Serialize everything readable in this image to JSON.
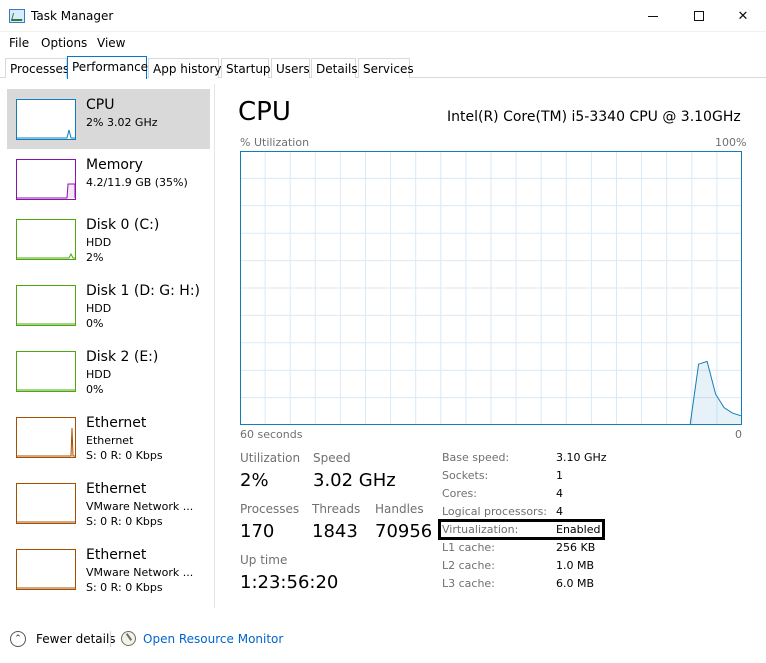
{
  "window": {
    "title": "Task Manager"
  },
  "menu": [
    "File",
    "Options",
    "View"
  ],
  "tabs": [
    "Processes",
    "Performance",
    "App history",
    "Startup",
    "Users",
    "Details",
    "Services"
  ],
  "active_tab": "Performance",
  "resources": [
    {
      "name": "CPU",
      "line1": "2% 3.02 GHz",
      "line2": "",
      "color": "#117dbb"
    },
    {
      "name": "Memory",
      "line1": "4.2/11.9 GB (35%)",
      "line2": "",
      "color": "#8b12ae"
    },
    {
      "name": "Disk 0 (C:)",
      "line1": "HDD",
      "line2": "2%",
      "color": "#4da60c"
    },
    {
      "name": "Disk 1 (D: G: H:)",
      "line1": "HDD",
      "line2": "0%",
      "color": "#4da60c"
    },
    {
      "name": "Disk 2 (E:)",
      "line1": "HDD",
      "line2": "0%",
      "color": "#4da60c"
    },
    {
      "name": "Ethernet",
      "line1": "Ethernet",
      "line2": "S: 0 R: 0 Kbps",
      "color": "#a74f01"
    },
    {
      "name": "Ethernet",
      "line1": "VMware Network ...",
      "line2": "S: 0 R: 0 Kbps",
      "color": "#a74f01"
    },
    {
      "name": "Ethernet",
      "line1": "VMware Network ...",
      "line2": "S: 0 R: 0 Kbps",
      "color": "#a74f01"
    }
  ],
  "main": {
    "title": "CPU",
    "cpu_name": "Intel(R) Core(TM) i5-3340 CPU @ 3.10GHz",
    "graph": {
      "top_left": "% Utilization",
      "top_right": "100%",
      "bottom_left": "60 seconds",
      "bottom_right": "0",
      "color": "#117dbb",
      "utilization_percent_series": [
        0,
        0,
        0,
        0,
        0,
        0,
        0,
        0,
        0,
        0,
        0,
        0,
        0,
        0,
        0,
        0,
        0,
        0,
        0,
        0,
        0,
        0,
        0,
        0,
        0,
        0,
        0,
        0,
        0,
        0,
        0,
        0,
        0,
        0,
        0,
        0,
        0,
        0,
        0,
        0,
        0,
        0,
        0,
        0,
        0,
        0,
        0,
        0,
        0,
        0,
        0,
        0,
        0,
        0,
        22,
        23,
        11,
        6,
        4,
        3
      ]
    },
    "stats": {
      "utilization_label": "Utilization",
      "utilization": "2%",
      "speed_label": "Speed",
      "speed": "3.02 GHz",
      "processes_label": "Processes",
      "processes": "170",
      "threads_label": "Threads",
      "threads": "1843",
      "handles_label": "Handles",
      "handles": "70956",
      "uptime_label": "Up time",
      "uptime": "1:23:56:20"
    },
    "details": [
      {
        "label": "Base speed:",
        "value": "3.10 GHz"
      },
      {
        "label": "Sockets:",
        "value": "1"
      },
      {
        "label": "Cores:",
        "value": "4"
      },
      {
        "label": "Logical processors:",
        "value": "4"
      },
      {
        "label": "Virtualization:",
        "value": "Enabled"
      },
      {
        "label": "L1 cache:",
        "value": "256 KB"
      },
      {
        "label": "L2 cache:",
        "value": "1.0 MB"
      },
      {
        "label": "L3 cache:",
        "value": "6.0 MB"
      }
    ]
  },
  "footer": {
    "fewer_details": "Fewer details",
    "open_resource_monitor": "Open Resource Monitor"
  }
}
